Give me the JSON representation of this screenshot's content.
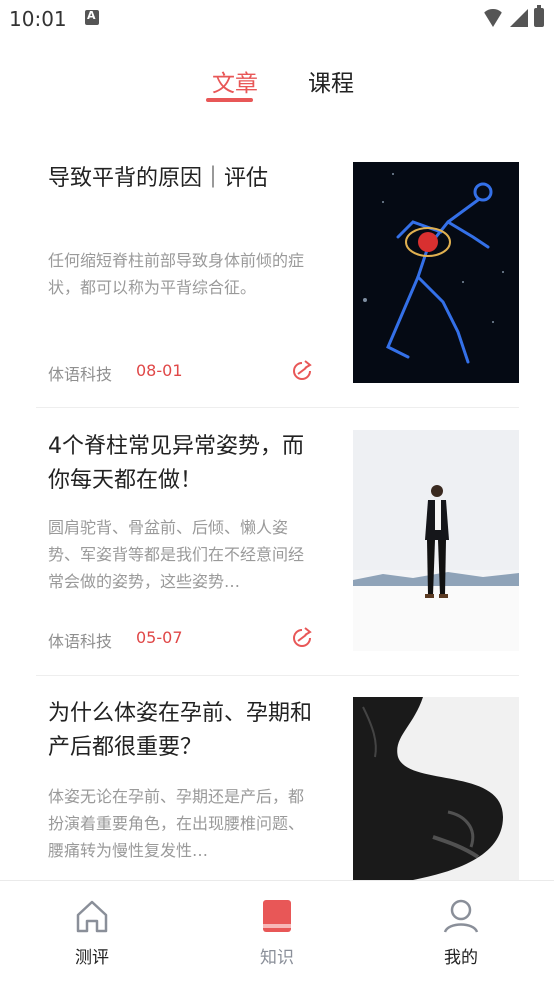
{
  "status_bar": {
    "time": "10:01"
  },
  "tabs": [
    {
      "label": "文章",
      "active": true
    },
    {
      "label": "课程",
      "active": false
    }
  ],
  "articles": [
    {
      "title": "导致平背的原因｜评估",
      "summary": "任何缩短脊柱前部导致身体前倾的症状，都可以称为平背综合征。",
      "source": "体语科技",
      "date": "08-01",
      "thumbnail": "glowing-skeleton-figure"
    },
    {
      "title": "4个脊柱常见异常姿势，而你每天都在做！",
      "summary": "圆肩驼背、骨盆前、后倾、懒人姿势、军姿背等都是我们在不经意间经常会做的姿势，这些姿势…",
      "source": "体语科技",
      "date": "05-07",
      "thumbnail": "man-standing-on-white-landscape"
    },
    {
      "title": "为什么体姿在孕前、孕期和产后都很重要？",
      "summary": "体姿无论在孕前、孕期还是产后，都扮演着重要角色，在出现腰椎问题、腰痛转为慢性复发性…",
      "source": "",
      "date": "",
      "thumbnail": "pregnant-belly-silhouette"
    }
  ],
  "bottom_nav": [
    {
      "label": "测评",
      "icon": "home-icon",
      "active": false
    },
    {
      "label": "知识",
      "icon": "book-icon",
      "active": true
    },
    {
      "label": "我的",
      "icon": "person-icon",
      "active": false
    }
  ],
  "colors": {
    "accent": "#e85757",
    "date": "#e04848",
    "inactive_nav": "#8a8f99"
  }
}
